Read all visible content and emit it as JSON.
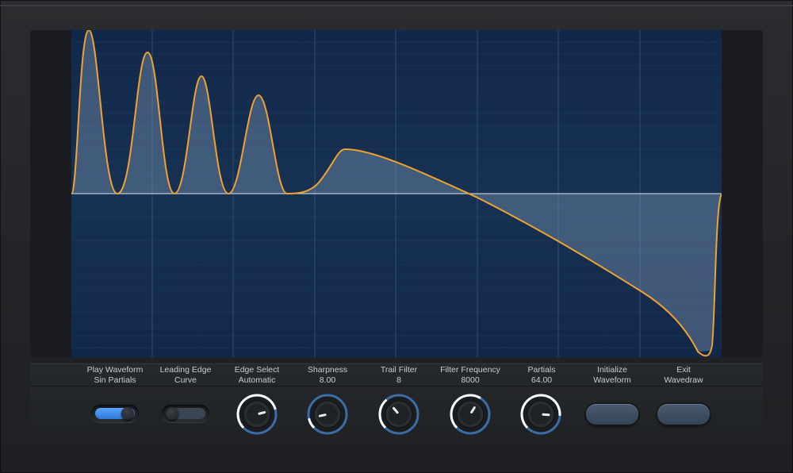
{
  "controls": [
    {
      "line1": "Play Waveform",
      "line2": "Sin Partials"
    },
    {
      "line1": "Leading Edge",
      "line2": "Curve"
    },
    {
      "line1": "Edge Select",
      "line2": "Automatic"
    },
    {
      "line1": "Sharpness",
      "line2": "8.00"
    },
    {
      "line1": "Trail Filter",
      "line2": "8"
    },
    {
      "line1": "Filter Frequency",
      "line2": "8000"
    },
    {
      "line1": "Partials",
      "line2": "64.00"
    },
    {
      "line1": "Initialize",
      "line2": "Waveform"
    },
    {
      "line1": "Exit",
      "line2": "Wavedraw"
    }
  ],
  "toggles": {
    "play_waveform_on": true,
    "leading_edge_on": false
  },
  "knob_levels": {
    "edge_select": 0.78,
    "sharpness": 0.12,
    "trail_filter": 0.35,
    "filter_frequency": 0.62,
    "partials": 0.85
  },
  "colors": {
    "accent_orange": "#f0a030",
    "display_bg": "#13294a",
    "toggle_blue": "#3d8ef0"
  }
}
